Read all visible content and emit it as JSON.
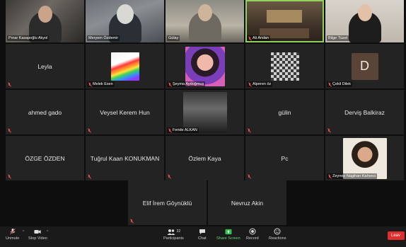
{
  "top_strip": [
    {
      "name": "Pınar Kasapoğlu Akyol",
      "muted": false
    },
    {
      "name": "Meryem Özdemir",
      "muted": false
    },
    {
      "name": "Gülay",
      "muted": false
    },
    {
      "name": "Ali Arslan",
      "muted": true,
      "active": true
    },
    {
      "name": "Bilge Tüzel",
      "muted": false
    }
  ],
  "grid": [
    {
      "type": "text",
      "name": "Leyla"
    },
    {
      "type": "image",
      "name": "Melek Esen"
    },
    {
      "type": "image",
      "name": "Şeyma Aydoğmuş"
    },
    {
      "type": "image",
      "name": "Alperen öz"
    },
    {
      "type": "avatar",
      "name": "Çekil Dilek",
      "initial": "D"
    },
    {
      "type": "text",
      "name": "ahmed gado"
    },
    {
      "type": "text",
      "name": "Veysel Kerem Hun"
    },
    {
      "type": "image",
      "name": "Feride ALKAN"
    },
    {
      "type": "text",
      "name": "gülin"
    },
    {
      "type": "text",
      "name": "Derviş Balkiraz"
    },
    {
      "type": "text",
      "name": "ÖZGE ÖZDEN"
    },
    {
      "type": "text",
      "name": "Tuğrul Kaan KONUKMAN"
    },
    {
      "type": "text",
      "name": "Özlem Kaya"
    },
    {
      "type": "text",
      "name": "Pc"
    },
    {
      "type": "image",
      "name": "Zeynep Nagihan Kahveci"
    }
  ],
  "last_row": [
    {
      "name": "Elif İrem Göynüklü"
    },
    {
      "name": "Nevruz Akin"
    }
  ],
  "toolbar": {
    "unmute": "Unmute",
    "stop_video": "Stop Video",
    "participants": "Participants",
    "participants_count": "22",
    "chat": "Chat",
    "share_screen": "Share Screen",
    "record": "Record",
    "reactions": "Reactions",
    "leave": "Leav"
  },
  "colors": {
    "active_speaker": "#8fd35b",
    "leave": "#e02f2f",
    "share": "#2fc24f",
    "muted": "#e04b4b"
  }
}
